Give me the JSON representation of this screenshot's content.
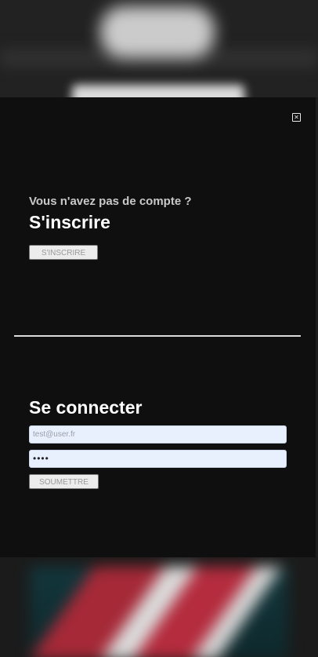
{
  "modal": {
    "close_glyph": "✕",
    "signup": {
      "subtitle": "Vous n'avez pas de compte ?",
      "title": "S'inscrire",
      "button_label": "S'INSCRIRE"
    },
    "login": {
      "title": "Se connecter",
      "email_placeholder": "test@user.fr",
      "password_value": "••••",
      "submit_label": "SOUMETTRE"
    }
  },
  "colors": {
    "modal_bg": "#0f0f10",
    "input_bg": "#e8f0fe",
    "button_bg": "#ececec"
  }
}
